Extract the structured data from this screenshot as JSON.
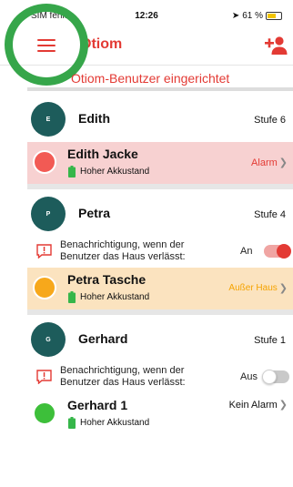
{
  "status_bar": {
    "carrier": "SIM fehlt",
    "time": "12:26",
    "battery": "61 %"
  },
  "app_bar": {
    "title": "Otiom",
    "menu_icon": "hamburger-menu-icon",
    "add_user_icon": "add-user-icon"
  },
  "banner": {
    "text": "Otiom-Benutzer eingerichtet"
  },
  "colors": {
    "accent": "#e33a34",
    "avatar": "#1d5c5b",
    "alarm_bg": "#f7d1d1",
    "away_bg": "#fbe3bf",
    "away_text": "#f5a300",
    "battery_green": "#36b64a",
    "highlight": "#36a64a"
  },
  "users": [
    {
      "initial": "E",
      "name": "Edith",
      "level": "Stufe 6",
      "device": {
        "name": "Edith Jacke",
        "battery": "Hoher Akkustand",
        "status": "Alarm",
        "state": "alarm"
      }
    },
    {
      "initial": "P",
      "name": "Petra",
      "level": "Stufe 4",
      "notification": {
        "text": "Benachrichtigung, wenn der Benutzer das Haus verlässt:",
        "state": "An",
        "enabled": true
      },
      "device": {
        "name": "Petra Tasche",
        "battery": "Hoher Akkustand",
        "status": "Außer Haus",
        "state": "away"
      }
    },
    {
      "initial": "G",
      "name": "Gerhard",
      "level": "Stufe 1",
      "notification": {
        "text": "Benachrichtigung, wenn der Benutzer das Haus verlässt:",
        "state": "Aus",
        "enabled": false
      },
      "device": {
        "name": "Gerhard 1",
        "battery": "Hoher Akkustand",
        "status": "Kein Alarm",
        "state": "ok"
      }
    }
  ]
}
